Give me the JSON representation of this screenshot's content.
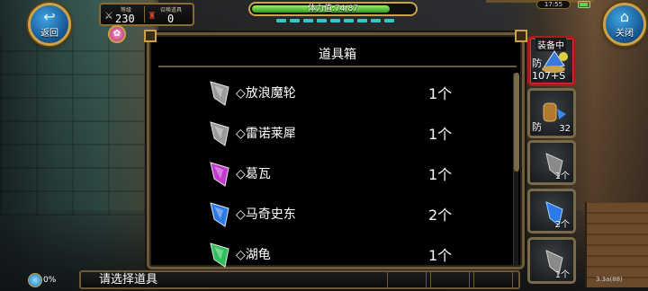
{
  "hud": {
    "back_label": "返回",
    "close_label": "关闭",
    "level_caption": "等级",
    "level_value": "230",
    "items_caption": "召唤道具",
    "items_value": "0",
    "stamina_text": "体力值:74/87",
    "stamina_fraction": 0.85,
    "clock": "17:55",
    "exp_percent": "0%",
    "version": "3.3a(88)"
  },
  "panel": {
    "title": "道具箱",
    "items": [
      {
        "name": "◇放浪魔轮",
        "qty": "1个",
        "color": "#9a9a9a"
      },
      {
        "name": "◇雷诺莱犀",
        "qty": "1个",
        "color": "#9a9a9a"
      },
      {
        "name": "◇葛瓦",
        "qty": "1个",
        "color": "#c23ad0"
      },
      {
        "name": "◇马奇史东",
        "qty": "2个",
        "color": "#2a7ae8"
      },
      {
        "name": "◇湖龟",
        "qty": "1个",
        "color": "#2fbf5a"
      }
    ]
  },
  "equipment": {
    "equipped_label": "装备中",
    "slot1_def_label": "防",
    "slot1_def_value": "107+S",
    "slot2_def_label": "防",
    "slot2_def_value": "32",
    "slot3_count": "1个",
    "slot4_count": "2个",
    "slot5_count": "1个"
  },
  "bottom": {
    "prompt": "请选择道具"
  },
  "colors": {
    "gold": "#c9a24a",
    "panel_border": "#6b5a3a",
    "active_border": "#a02020"
  }
}
